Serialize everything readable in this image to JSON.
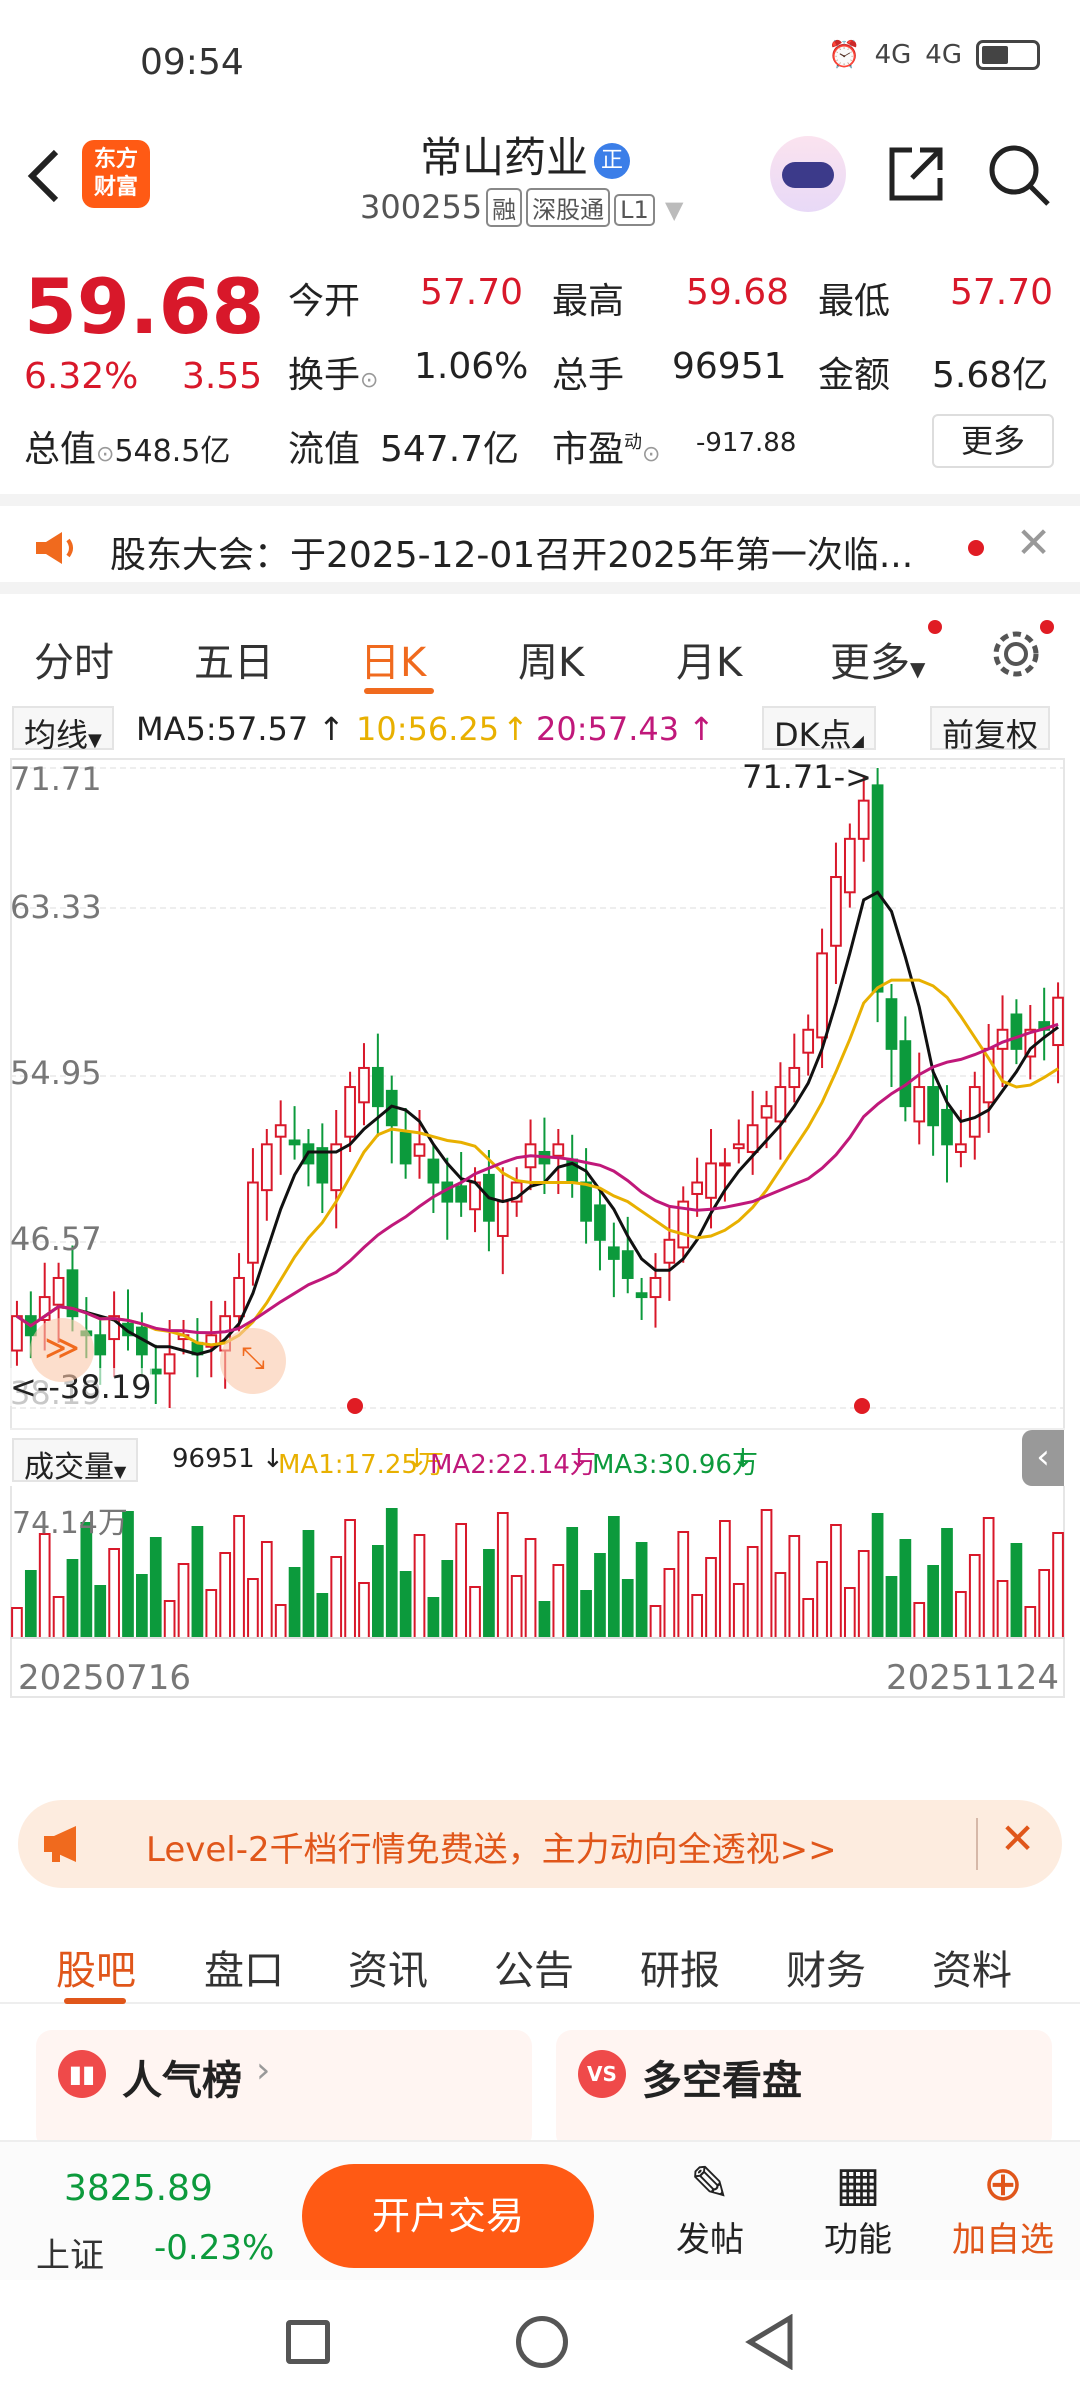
{
  "status": {
    "time": "09:54",
    "net1": "4G",
    "net2": "4G"
  },
  "header": {
    "logo_line1": "东方",
    "logo_line2": "财富",
    "stock_name": "常山药业",
    "name_badge": "正",
    "code": "300255",
    "tags": [
      "融",
      "深股通",
      "L1"
    ]
  },
  "quote": {
    "price": "59.68",
    "change_pct": "6.32%",
    "change": "3.55",
    "open_label": "今开",
    "open": "57.70",
    "high_label": "最高",
    "high": "59.68",
    "low_label": "最低",
    "low": "57.70",
    "turnover_label": "换手",
    "turnover": "1.06%",
    "volume_label": "总手",
    "volume": "96951",
    "amount_label": "金额",
    "amount": "5.68亿",
    "mktcap_label": "总值",
    "mktcap": "548.5亿",
    "float_label": "流值",
    "float": "547.7亿",
    "pe_label": "市盈",
    "pe_sup": "动",
    "pe": "-917.88",
    "more": "更多"
  },
  "notice": {
    "text": "股东大会：于2025-12-01召开2025年第一次临..."
  },
  "tabs": [
    "分时",
    "五日",
    "日K",
    "周K",
    "月K",
    "更多"
  ],
  "kbar": {
    "ma_btn": "均线",
    "ma5": "MA5:57.57",
    "ma10": "10:56.25",
    "ma20": "20:57.43",
    "dk": "DK点",
    "fq": "前复权"
  },
  "price_axis": [
    "71.71",
    "63.33",
    "54.95",
    "46.57",
    "38.19"
  ],
  "annot": {
    "high": "71.71->",
    "low": "<--38.19"
  },
  "vol": {
    "btn": "成交量",
    "value": "96951",
    "ma1": "MA1:17.25万",
    "ma2": "MA2:22.14万",
    "ma3": "MA3:30.96万",
    "max": "74.14万",
    "date_start": "20250716",
    "date_end": "20251124"
  },
  "level2": {
    "text": "Level-2千档行情免费送，主力动向全透视>>"
  },
  "subtabs": [
    "股吧",
    "盘口",
    "资讯",
    "公告",
    "研报",
    "财务",
    "资料"
  ],
  "cards": {
    "left": "人气榜",
    "right": "多空看盘"
  },
  "bottom": {
    "index_value": "3825.89",
    "index_name": "上证",
    "index_change": "-0.23%",
    "trade": "开户交易",
    "post": "发帖",
    "func": "功能",
    "add": "加自选"
  },
  "chart_data": {
    "type": "candlestick",
    "ylim": [
      38.19,
      71.71
    ],
    "high_value": 71.71,
    "low_value": 38.19,
    "close": [
      43,
      42,
      44,
      45,
      43,
      42,
      41,
      43,
      42,
      41,
      40,
      41,
      42,
      41,
      42,
      43,
      45,
      50,
      52,
      53,
      52,
      51,
      50,
      52,
      55,
      56,
      54,
      53,
      51,
      52,
      50,
      49,
      49,
      50,
      48,
      49,
      50,
      52,
      51,
      52,
      50,
      48,
      47,
      46,
      45,
      44,
      45,
      47,
      49,
      50,
      51,
      51,
      52,
      53,
      54,
      55,
      56,
      58,
      62,
      66,
      68,
      70,
      60,
      57,
      54,
      55,
      53,
      52,
      52,
      55,
      57,
      58,
      57,
      58,
      58,
      59.68
    ]
  }
}
